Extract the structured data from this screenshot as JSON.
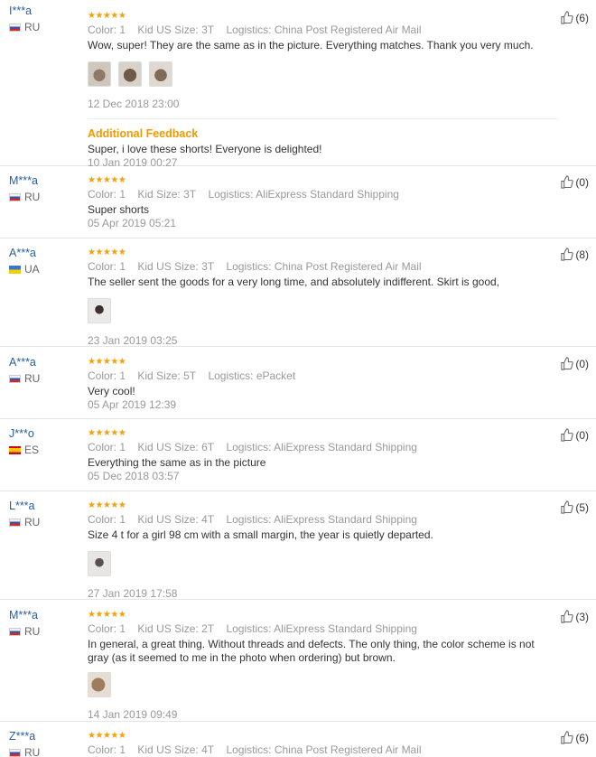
{
  "labels": {
    "color": "Color:",
    "kid_us_size": "Kid US Size:",
    "kid_size": "Kid Size:",
    "logistics": "Logistics:",
    "additional_feedback": "Additional Feedback"
  },
  "stars_glyph": "★★★★★",
  "accent_colors": {
    "username": "#2a5d9f",
    "stars": "#f2a10c",
    "additional_feedback": "#f29a00"
  },
  "reviews": [
    {
      "user": "I***a",
      "country": "RU",
      "rating": 5,
      "color": "1",
      "size": "3T",
      "logistics": "China Post Registered Air Mail",
      "text": "Wow, super! They are the same as in the picture. Everything matches. Thank you very much.",
      "date": "12 Dec 2018 23:00",
      "likes": "(6)",
      "photos": 3,
      "additional": {
        "text": "Super, i love these shorts! Everyone is delighted!",
        "date": "10 Jan 2019 00:27"
      }
    },
    {
      "user": "M***a",
      "country": "RU",
      "rating": 5,
      "color": "1",
      "size": "3T",
      "logistics": "AliExpress Standard Shipping",
      "text": "Super shorts",
      "date": "05 Apr 2019 05:21",
      "likes": "(0)",
      "photos": 0
    },
    {
      "user": "A***a",
      "country": "UA",
      "rating": 5,
      "color": "1",
      "size": "3T",
      "logistics": "China Post Registered Air Mail",
      "text": "The seller sent the goods for a very long time, and absolutely indifferent. Skirt is good,",
      "date": "23 Jan 2019 03:25",
      "likes": "(8)",
      "photos": 1
    },
    {
      "user": "A***a",
      "country": "RU",
      "rating": 5,
      "color": "1",
      "size": "5T",
      "logistics": "ePacket",
      "text": "Very cool!",
      "date": "05 Apr 2019 12:39",
      "likes": "(0)",
      "photos": 0
    },
    {
      "user": "J***o",
      "country": "ES",
      "rating": 5,
      "color": "1",
      "size": "6T",
      "logistics": "AliExpress Standard Shipping",
      "text": "Everything the same as in the picture",
      "date": "05 Dec 2018 03:57",
      "likes": "(0)",
      "photos": 0
    },
    {
      "user": "L***a",
      "country": "RU",
      "rating": 5,
      "color": "1",
      "size": "4T",
      "logistics": "AliExpress Standard Shipping",
      "text": "Size 4 t for a girl 98 cm with a small margin, the year is quietly departed.",
      "date": "27 Jan 2019 17:58",
      "likes": "(5)",
      "photos": 1
    },
    {
      "user": "M***a",
      "country": "RU",
      "rating": 5,
      "color": "1",
      "size": "2T",
      "logistics": "AliExpress Standard Shipping",
      "text": "In general, a great thing. Without threads and defects. The only thing, the color scheme is not gray (as it seemed to me in the photo when ordering) but brown.",
      "date": "14 Jan 2019 09:49",
      "likes": "(3)",
      "photos": 1
    },
    {
      "user": "Z***a",
      "country": "RU",
      "rating": 5,
      "color": "1",
      "size": "4T",
      "logistics": "China Post Registered Air Mail",
      "text": "",
      "date": "",
      "likes": "(6)",
      "photos": 0
    }
  ]
}
